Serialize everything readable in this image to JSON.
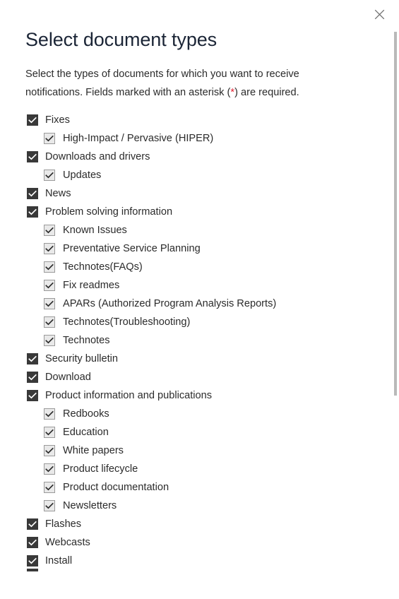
{
  "dialog": {
    "title": "Select document types",
    "description_part1": "Select the types of documents for which you want to receive notifications. Fields marked with an asterisk (",
    "description_asterisk": "*",
    "description_part2": ") are required.",
    "close_label": "Close",
    "close_icon": "close-icon"
  },
  "colors": {
    "parent_checkbox_fill": "#393939",
    "parent_check_mark": "#ffffff",
    "child_checkbox_fill": "#e9e9e9",
    "child_checkbox_border": "#9a9a9a",
    "child_check_mark": "#2b2b2b",
    "text": "#2b2b2b",
    "title": "#1b2536",
    "required_asterisk": "#e32636",
    "scrollbar_thumb": "#b9b9b9",
    "background": "#ffffff"
  },
  "document_types": [
    {
      "label": "Fixes",
      "level": 0,
      "checked": true
    },
    {
      "label": "High-Impact / Pervasive (HIPER)",
      "level": 1,
      "checked": true
    },
    {
      "label": "Downloads and drivers",
      "level": 0,
      "checked": true
    },
    {
      "label": "Updates",
      "level": 1,
      "checked": true
    },
    {
      "label": "News",
      "level": 0,
      "checked": true
    },
    {
      "label": "Problem solving information",
      "level": 0,
      "checked": true
    },
    {
      "label": "Known Issues",
      "level": 1,
      "checked": true
    },
    {
      "label": "Preventative Service Planning",
      "level": 1,
      "checked": true
    },
    {
      "label": "Technotes(FAQs)",
      "level": 1,
      "checked": true
    },
    {
      "label": "Fix readmes",
      "level": 1,
      "checked": true
    },
    {
      "label": "APARs (Authorized Program Analysis Reports)",
      "level": 1,
      "checked": true
    },
    {
      "label": "Technotes(Troubleshooting)",
      "level": 1,
      "checked": true
    },
    {
      "label": "Technotes",
      "level": 1,
      "checked": true
    },
    {
      "label": "Security bulletin",
      "level": 0,
      "checked": true
    },
    {
      "label": "Download",
      "level": 0,
      "checked": true
    },
    {
      "label": "Product information and publications",
      "level": 0,
      "checked": true
    },
    {
      "label": "Redbooks",
      "level": 1,
      "checked": true
    },
    {
      "label": "Education",
      "level": 1,
      "checked": true
    },
    {
      "label": "White papers",
      "level": 1,
      "checked": true
    },
    {
      "label": "Product lifecycle",
      "level": 1,
      "checked": true
    },
    {
      "label": "Product documentation",
      "level": 1,
      "checked": true
    },
    {
      "label": "Newsletters",
      "level": 1,
      "checked": true
    },
    {
      "label": "Flashes",
      "level": 0,
      "checked": true
    },
    {
      "label": "Webcasts",
      "level": 0,
      "checked": true
    },
    {
      "label": "Install",
      "level": 0,
      "checked": true
    }
  ]
}
